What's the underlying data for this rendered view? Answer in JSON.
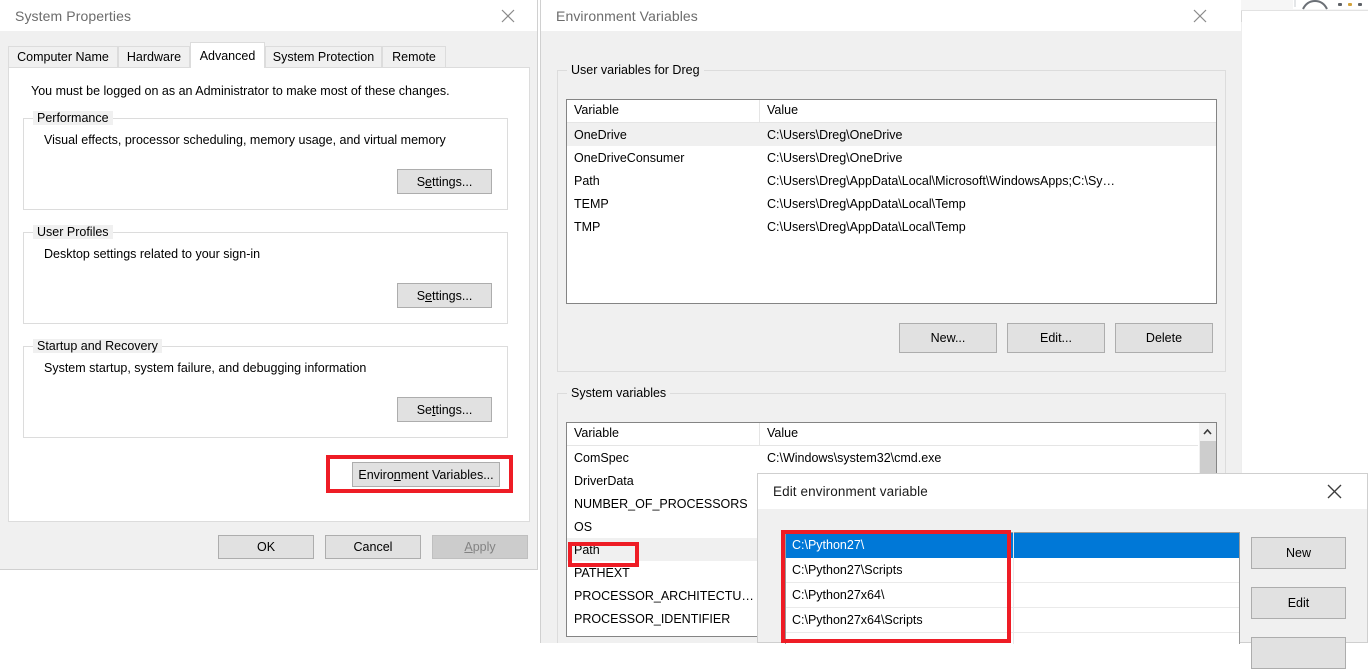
{
  "background": {
    "name": "browser-window-behind"
  },
  "system_properties": {
    "title": "System Properties",
    "close_label": "×",
    "tabs": [
      {
        "label": "Computer Name",
        "active": false
      },
      {
        "label": "Hardware",
        "active": false
      },
      {
        "label": "Advanced",
        "active": true
      },
      {
        "label": "System Protection",
        "active": false
      },
      {
        "label": "Remote",
        "active": false
      }
    ],
    "notice": "You must be logged on as an Administrator to make most of these changes.",
    "groups": [
      {
        "title": "Performance",
        "description": "Visual effects, processor scheduling, memory usage, and virtual memory",
        "button": "Settings...",
        "accesskey": "S"
      },
      {
        "title": "User Profiles",
        "description": "Desktop settings related to your sign-in",
        "button": "Settings...",
        "accesskey": "e"
      },
      {
        "title": "Startup and Recovery",
        "description": "System startup, system failure, and debugging information",
        "button": "Settings...",
        "accesskey": "tt"
      }
    ],
    "environment_variables_button": "Environment Variables...",
    "footer_buttons": [
      {
        "label": "OK",
        "disabled": false
      },
      {
        "label": "Cancel",
        "disabled": false
      },
      {
        "label": "Apply",
        "disabled": true
      }
    ]
  },
  "environment_variables": {
    "title": "Environment Variables",
    "close_label": "×",
    "user_section": {
      "title": "User variables for Dreg",
      "columns": [
        "Variable",
        "Value"
      ],
      "rows": [
        {
          "variable": "OneDrive",
          "value": "C:\\Users\\Dreg\\OneDrive",
          "selected": true
        },
        {
          "variable": "OneDriveConsumer",
          "value": "C:\\Users\\Dreg\\OneDrive",
          "selected": false
        },
        {
          "variable": "Path",
          "value": "C:\\Users\\Dreg\\AppData\\Local\\Microsoft\\WindowsApps;C:\\Sy…",
          "selected": false
        },
        {
          "variable": "TEMP",
          "value": "C:\\Users\\Dreg\\AppData\\Local\\Temp",
          "selected": false
        },
        {
          "variable": "TMP",
          "value": "C:\\Users\\Dreg\\AppData\\Local\\Temp",
          "selected": false
        }
      ],
      "buttons": [
        "New...",
        "Edit...",
        "Delete"
      ]
    },
    "system_section": {
      "title": "System variables",
      "columns": [
        "Variable",
        "Value"
      ],
      "rows": [
        {
          "variable": "ComSpec",
          "value": "C:\\Windows\\system32\\cmd.exe",
          "selected": false
        },
        {
          "variable": "DriverData",
          "value": "",
          "selected": false
        },
        {
          "variable": "NUMBER_OF_PROCESSORS",
          "value": "",
          "selected": false
        },
        {
          "variable": "OS",
          "value": "",
          "selected": false
        },
        {
          "variable": "Path",
          "value": "",
          "selected": true
        },
        {
          "variable": "PATHEXT",
          "value": "",
          "selected": false
        },
        {
          "variable": "PROCESSOR_ARCHITECTU…",
          "value": "",
          "selected": false
        },
        {
          "variable": "PROCESSOR_IDENTIFIER",
          "value": "",
          "selected": false
        }
      ]
    }
  },
  "edit_environment_variable": {
    "title": "Edit environment variable",
    "close_label": "×",
    "entries": [
      {
        "value": "C:\\Python27\\",
        "selected": true
      },
      {
        "value": "C:\\Python27\\Scripts",
        "selected": false
      },
      {
        "value": "C:\\Python27x64\\",
        "selected": false
      },
      {
        "value": "C:\\Python27x64\\Scripts",
        "selected": false
      }
    ],
    "buttons": [
      "New",
      "Edit"
    ]
  },
  "annotations": {
    "color": "#ee1c25",
    "boxes": [
      "environment-variables-button",
      "system-path-row",
      "python27-entries"
    ]
  }
}
